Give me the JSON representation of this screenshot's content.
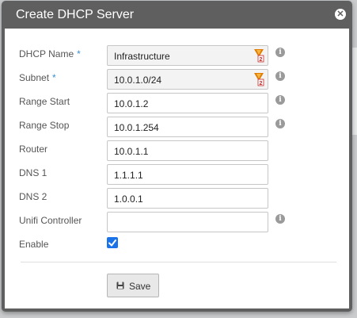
{
  "dialog": {
    "title": "Create DHCP Server",
    "close_glyph": "✕"
  },
  "fields": [
    {
      "label": "DHCP Name",
      "required": "*",
      "value": "Infrastructure"
    },
    {
      "label": "Subnet",
      "required": "*",
      "value": "10.0.1.0/24"
    },
    {
      "label": "Range Start",
      "value": "10.0.1.2"
    },
    {
      "label": "Range Stop",
      "value": "10.0.1.254"
    },
    {
      "label": "Router",
      "value": "10.0.1.1"
    },
    {
      "label": "DNS 1",
      "value": "1.1.1.1"
    },
    {
      "label": "DNS 2",
      "value": "1.0.0.1"
    },
    {
      "label": "Unifi Controller",
      "value": ""
    }
  ],
  "enable": {
    "label": "Enable",
    "checked": true
  },
  "info_glyph": "i",
  "save_button": {
    "label": "Save",
    "icon": "floppy-disk-icon"
  },
  "colors": {
    "accent": "#1a73e8",
    "required": "#3a8fd4",
    "titlebar": "#5f5f5f"
  }
}
